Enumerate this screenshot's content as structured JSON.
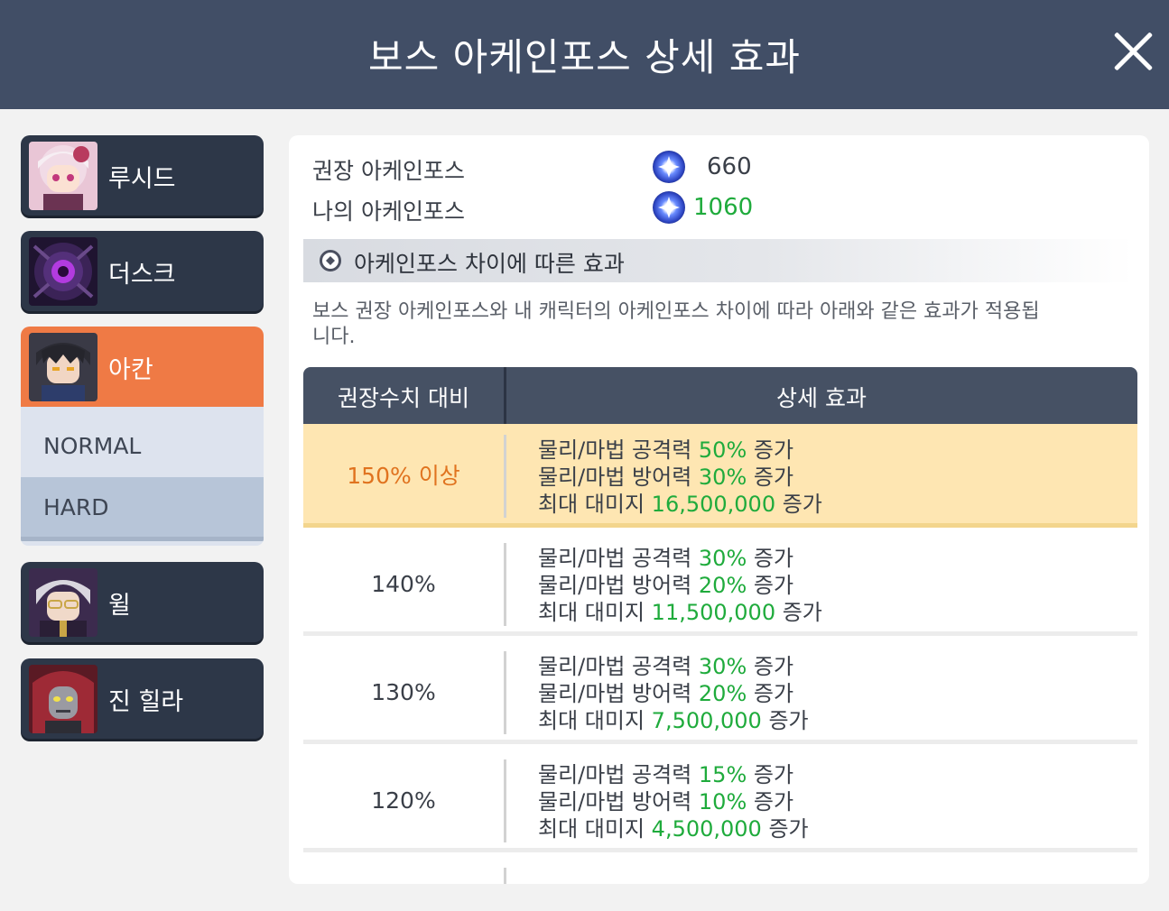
{
  "header": {
    "title": "보스 아케인포스 상세 효과"
  },
  "sidebar": {
    "bosses": [
      {
        "name": "루시드",
        "active": false
      },
      {
        "name": "더스크",
        "active": false
      },
      {
        "name": "아칸",
        "active": true
      },
      {
        "name": "윌",
        "active": false
      },
      {
        "name": "진 힐라",
        "active": false
      }
    ],
    "difficulties": [
      "NORMAL",
      "HARD"
    ],
    "selected_difficulty": "HARD"
  },
  "stats": {
    "recommended_label": "권장 아케인포스",
    "recommended_value": "660",
    "mine_label": "나의 아케인포스",
    "mine_value": "1060"
  },
  "section": {
    "title": "아케인포스 차이에 따른 효과",
    "description": "보스 권장 아케인포스와 내 캐릭터의 아케인포스 차이에 따라 아래와 같은 효과가 적용됩니다."
  },
  "table": {
    "headers": [
      "권장수치 대비",
      "상세 효과"
    ],
    "rows": [
      {
        "pct": "150% 이상",
        "highlight": true,
        "lines": [
          {
            "pre": "물리/마법 공격력 ",
            "val": "50%",
            "post": " 증가"
          },
          {
            "pre": "물리/마법 방어력 ",
            "val": "30%",
            "post": " 증가"
          },
          {
            "pre": "최대 대미지 ",
            "val": "16,500,000",
            "post": " 증가"
          }
        ]
      },
      {
        "pct": "140%",
        "highlight": false,
        "lines": [
          {
            "pre": "물리/마법 공격력 ",
            "val": "30%",
            "post": " 증가"
          },
          {
            "pre": "물리/마법 방어력 ",
            "val": "20%",
            "post": " 증가"
          },
          {
            "pre": "최대 대미지 ",
            "val": "11,500,000",
            "post": " 증가"
          }
        ]
      },
      {
        "pct": "130%",
        "highlight": false,
        "lines": [
          {
            "pre": "물리/마법 공격력 ",
            "val": "30%",
            "post": " 증가"
          },
          {
            "pre": "물리/마법 방어력 ",
            "val": "20%",
            "post": " 증가"
          },
          {
            "pre": "최대 대미지 ",
            "val": "7,500,000",
            "post": " 증가"
          }
        ]
      },
      {
        "pct": "120%",
        "highlight": false,
        "lines": [
          {
            "pre": "물리/마법 공격력 ",
            "val": "15%",
            "post": " 증가"
          },
          {
            "pre": "물리/마법 방어력 ",
            "val": "10%",
            "post": " 증가"
          },
          {
            "pre": "최대 대미지 ",
            "val": "4,500,000",
            "post": " 증가"
          }
        ]
      }
    ]
  },
  "colors": {
    "header_bg": "#414e66",
    "active_accent": "#ef7a45",
    "positive_value": "#1fab3c",
    "highlight_row": "#fee6b2"
  }
}
